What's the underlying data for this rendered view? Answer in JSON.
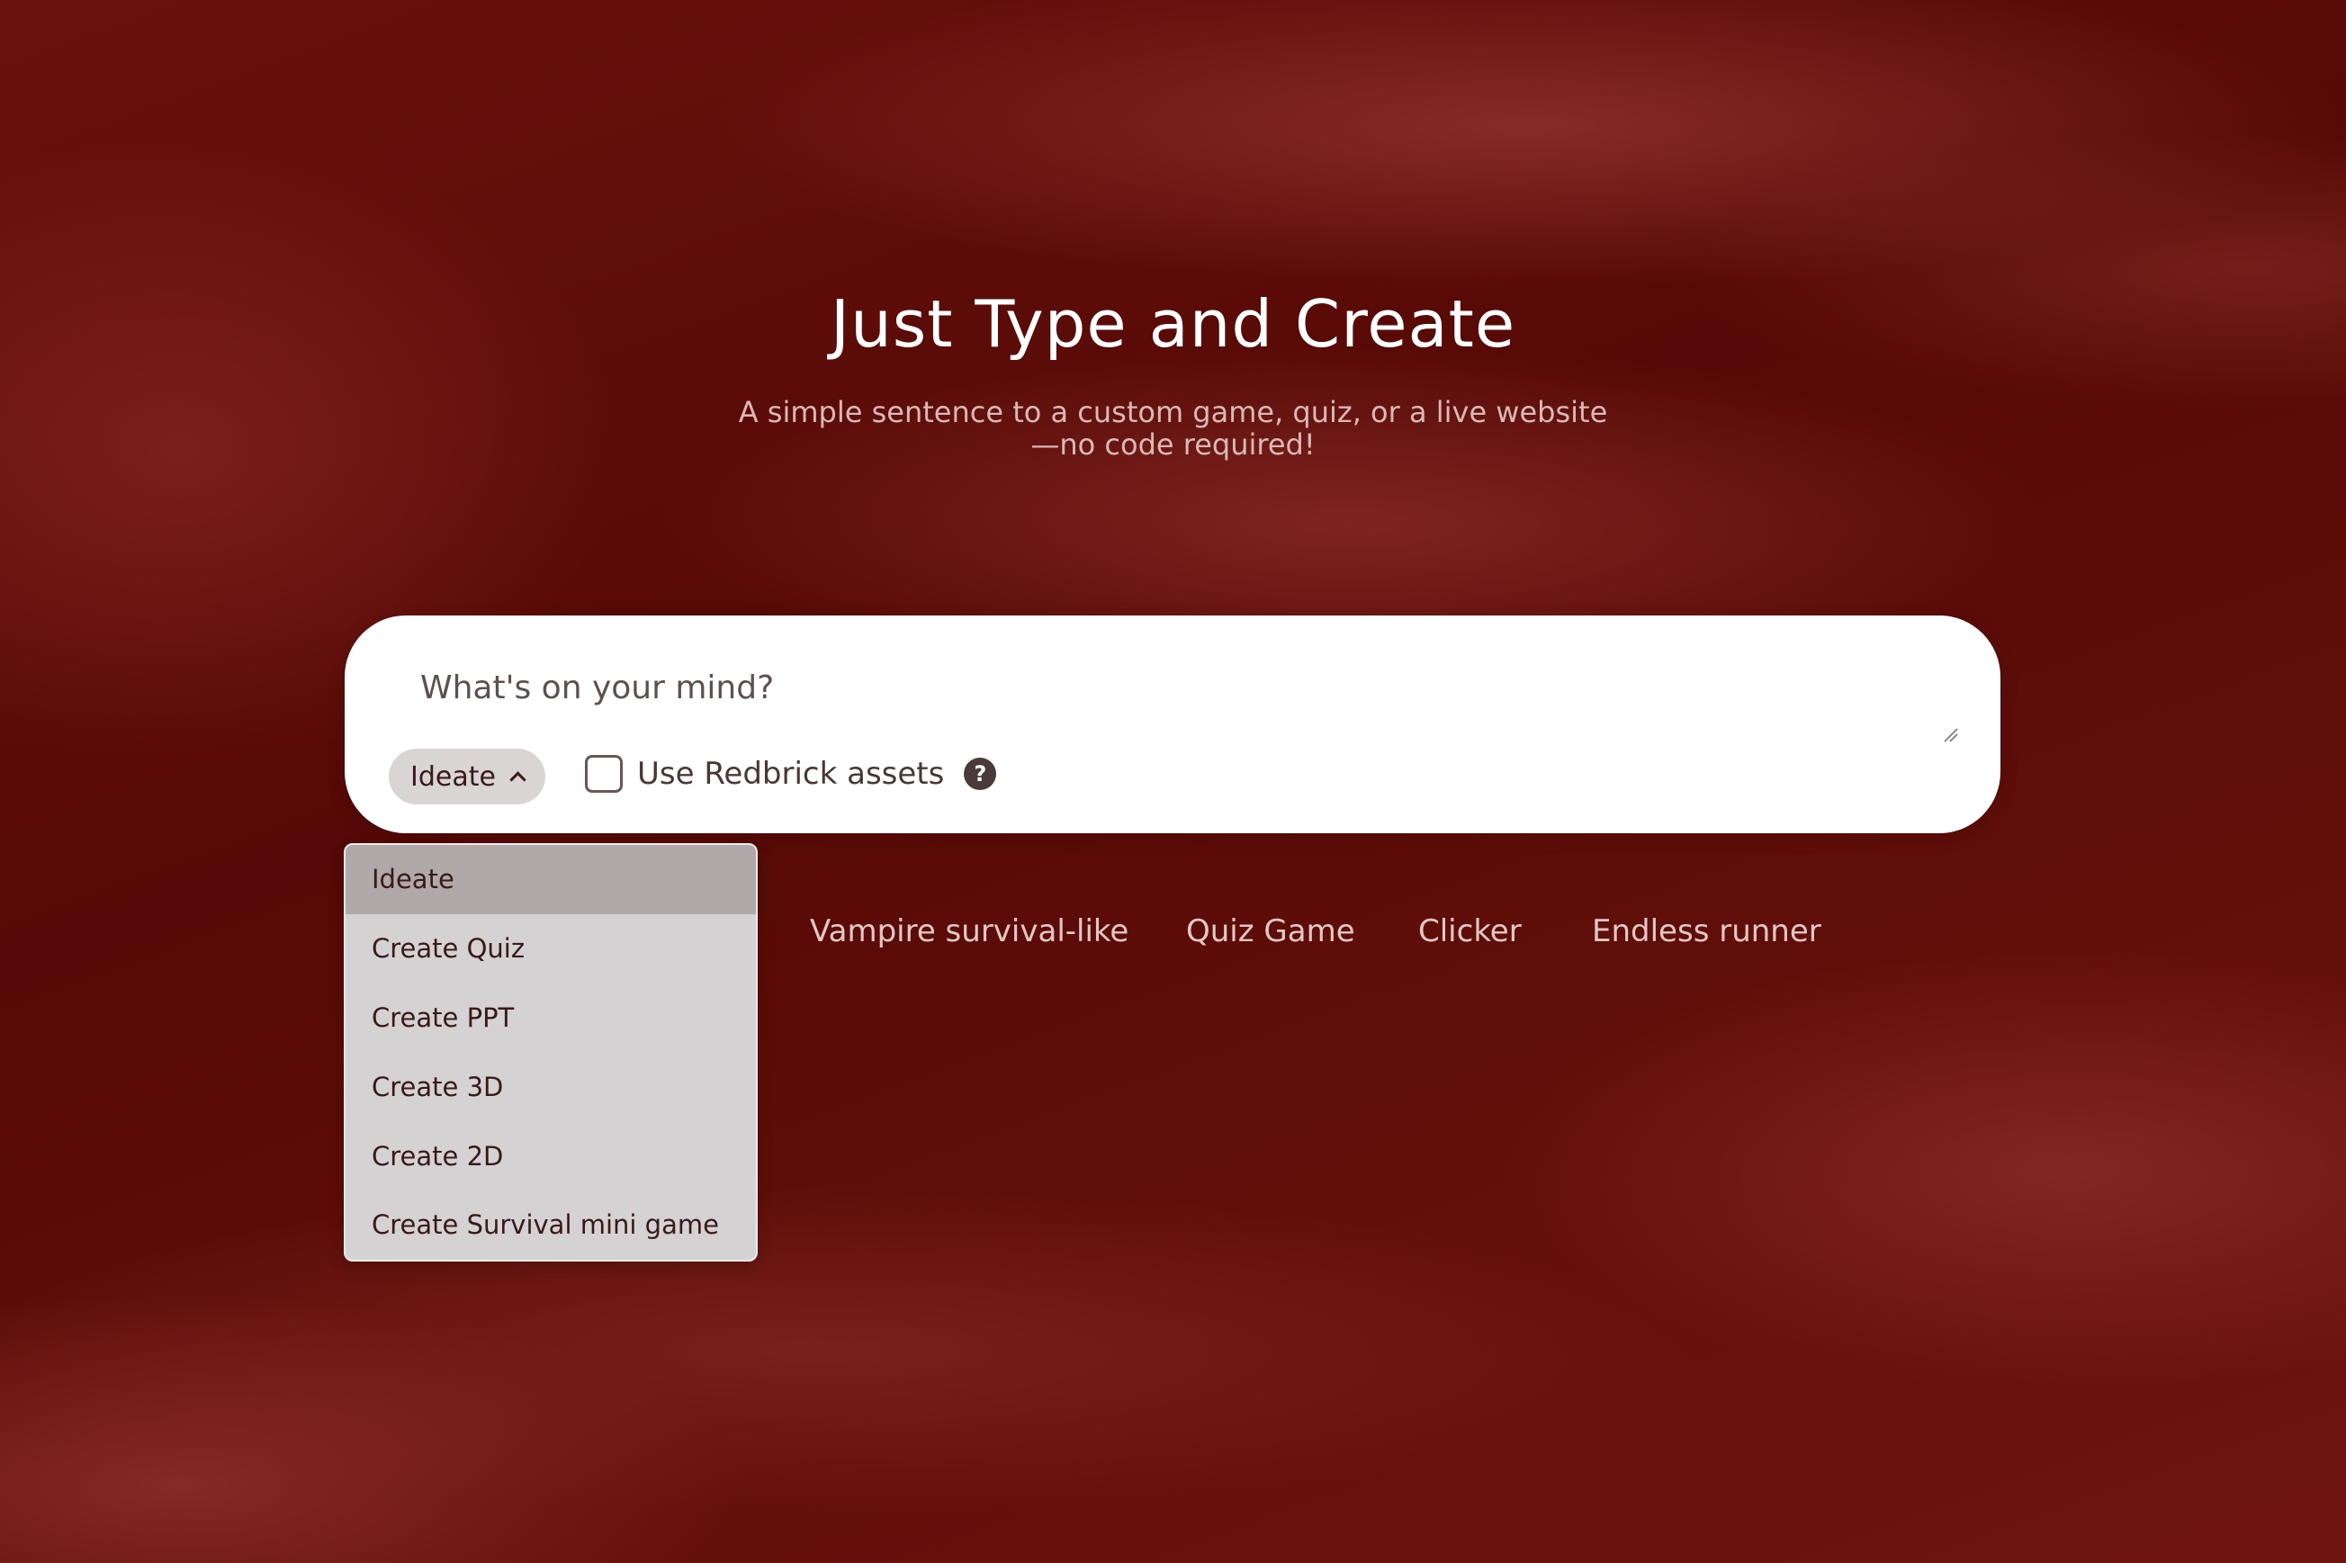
{
  "hero": {
    "title": "Just Type and Create",
    "subtitle_line1": "A simple sentence to a custom game, quiz, or a live website",
    "subtitle_line2": "—no code required!"
  },
  "prompt": {
    "placeholder": "What's on your mind?",
    "value": ""
  },
  "mode_select": {
    "selected": "Ideate",
    "expanded": true,
    "options": [
      "Ideate",
      "Create Quiz",
      "Create PPT",
      "Create 3D",
      "Create 2D",
      "Create Survival mini game"
    ]
  },
  "assets_option": {
    "label": "Use Redbrick assets",
    "checked": false,
    "help_glyph": "?"
  },
  "suggestions": [
    "Vampire survival-like",
    "Quiz Game",
    "Clicker",
    "Endless runner"
  ],
  "colors": {
    "background": "#5e0c08",
    "card": "#ffffff",
    "dropdown_bg": "#d4d2d2",
    "dropdown_selected": "#b0a9a9",
    "suggestion_text": "#e3c7c5"
  },
  "icons": {
    "chevron": "chevron-up-icon",
    "help": "question-circle-icon",
    "resize": "resize-handle-icon"
  }
}
